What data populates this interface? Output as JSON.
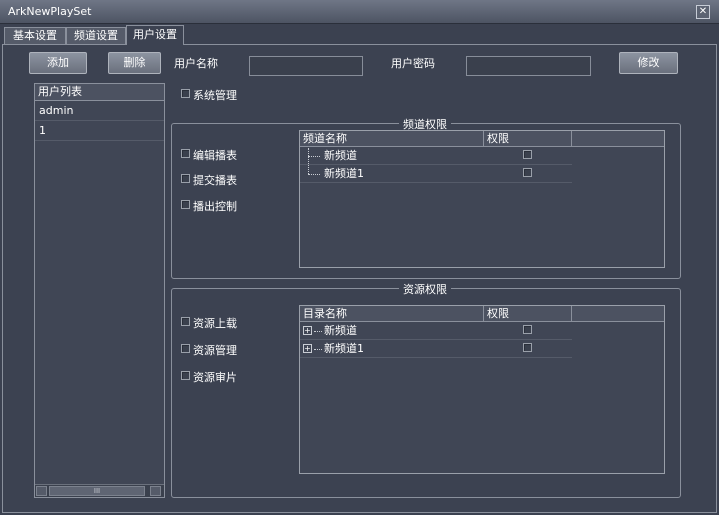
{
  "window": {
    "title": "ArkNewPlaySet",
    "close_icon": "close-icon"
  },
  "tabs": [
    {
      "label": "基本设置",
      "active": false
    },
    {
      "label": "频道设置",
      "active": false
    },
    {
      "label": "用户设置",
      "active": true
    }
  ],
  "toolbar": {
    "add_label": "添加",
    "delete_label": "删除",
    "username_label": "用户名称",
    "username_value": "",
    "password_label": "用户密码",
    "password_value": "",
    "modify_label": "修改"
  },
  "user_list": {
    "header": "用户列表",
    "rows": [
      "admin",
      "1"
    ]
  },
  "system_admin": {
    "label": "系统管理",
    "checked": false
  },
  "channel_permissions": {
    "title": "频道权限",
    "checkboxes": [
      {
        "label": "编辑播表",
        "checked": false
      },
      {
        "label": "提交播表",
        "checked": false
      },
      {
        "label": "播出控制",
        "checked": false
      }
    ],
    "table": {
      "columns": [
        "频道名称",
        "权限",
        ""
      ],
      "rows": [
        {
          "name": "新频道",
          "permission": false
        },
        {
          "name": "新频道1",
          "permission": false
        }
      ]
    }
  },
  "resource_permissions": {
    "title": "资源权限",
    "checkboxes": [
      {
        "label": "资源上载",
        "checked": false
      },
      {
        "label": "资源管理",
        "checked": false
      },
      {
        "label": "资源审片",
        "checked": false
      }
    ],
    "table": {
      "columns": [
        "目录名称",
        "权限",
        ""
      ],
      "rows": [
        {
          "name": "新频道",
          "permission": false
        },
        {
          "name": "新频道1",
          "permission": false
        }
      ]
    }
  },
  "scrollbar": {
    "thumb_label": "III"
  }
}
